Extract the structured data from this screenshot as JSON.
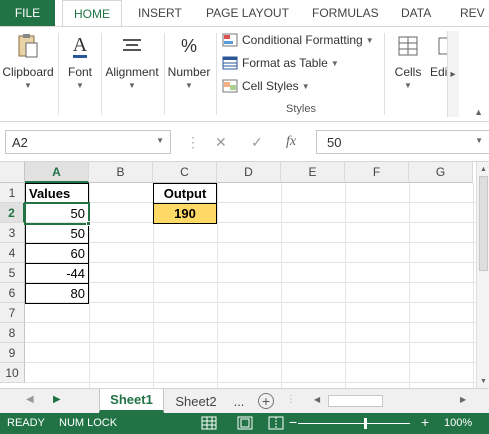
{
  "ribbon": {
    "tabs": [
      "FILE",
      "HOME",
      "INSERT",
      "PAGE LAYOUT",
      "FORMULAS",
      "DATA",
      "REV"
    ],
    "groups": {
      "clipboard": "Clipboard",
      "font": "Font",
      "alignment": "Alignment",
      "number": "Number",
      "cells": "Cells",
      "editing": "Edi"
    },
    "styles": {
      "conditional_formatting": "Conditional Formatting",
      "format_as_table": "Format as Table",
      "cell_styles": "Cell Styles",
      "caption": "Styles"
    },
    "number_symbol": "%",
    "font_symbol": "A"
  },
  "formula_bar": {
    "name_box": "A2",
    "fx": "fx",
    "value": "50"
  },
  "sheet": {
    "columns": [
      "A",
      "B",
      "C",
      "D",
      "E",
      "F",
      "G"
    ],
    "rows": [
      "1",
      "2",
      "3",
      "4",
      "5",
      "6",
      "7",
      "8",
      "9",
      "10"
    ],
    "a1": "Values",
    "values": [
      "50",
      "50",
      "60",
      "-44",
      "80"
    ],
    "c1": "Output",
    "c2": "190"
  },
  "sheet_tabs": {
    "tabs": [
      "Sheet1",
      "Sheet2"
    ],
    "more": "..."
  },
  "status": {
    "ready": "READY",
    "num_lock": "NUM LOCK",
    "zoom": "100%",
    "minus": "−",
    "plus": "+"
  },
  "colors": {
    "accent": "#217346",
    "output_fill": "#ffd966"
  }
}
